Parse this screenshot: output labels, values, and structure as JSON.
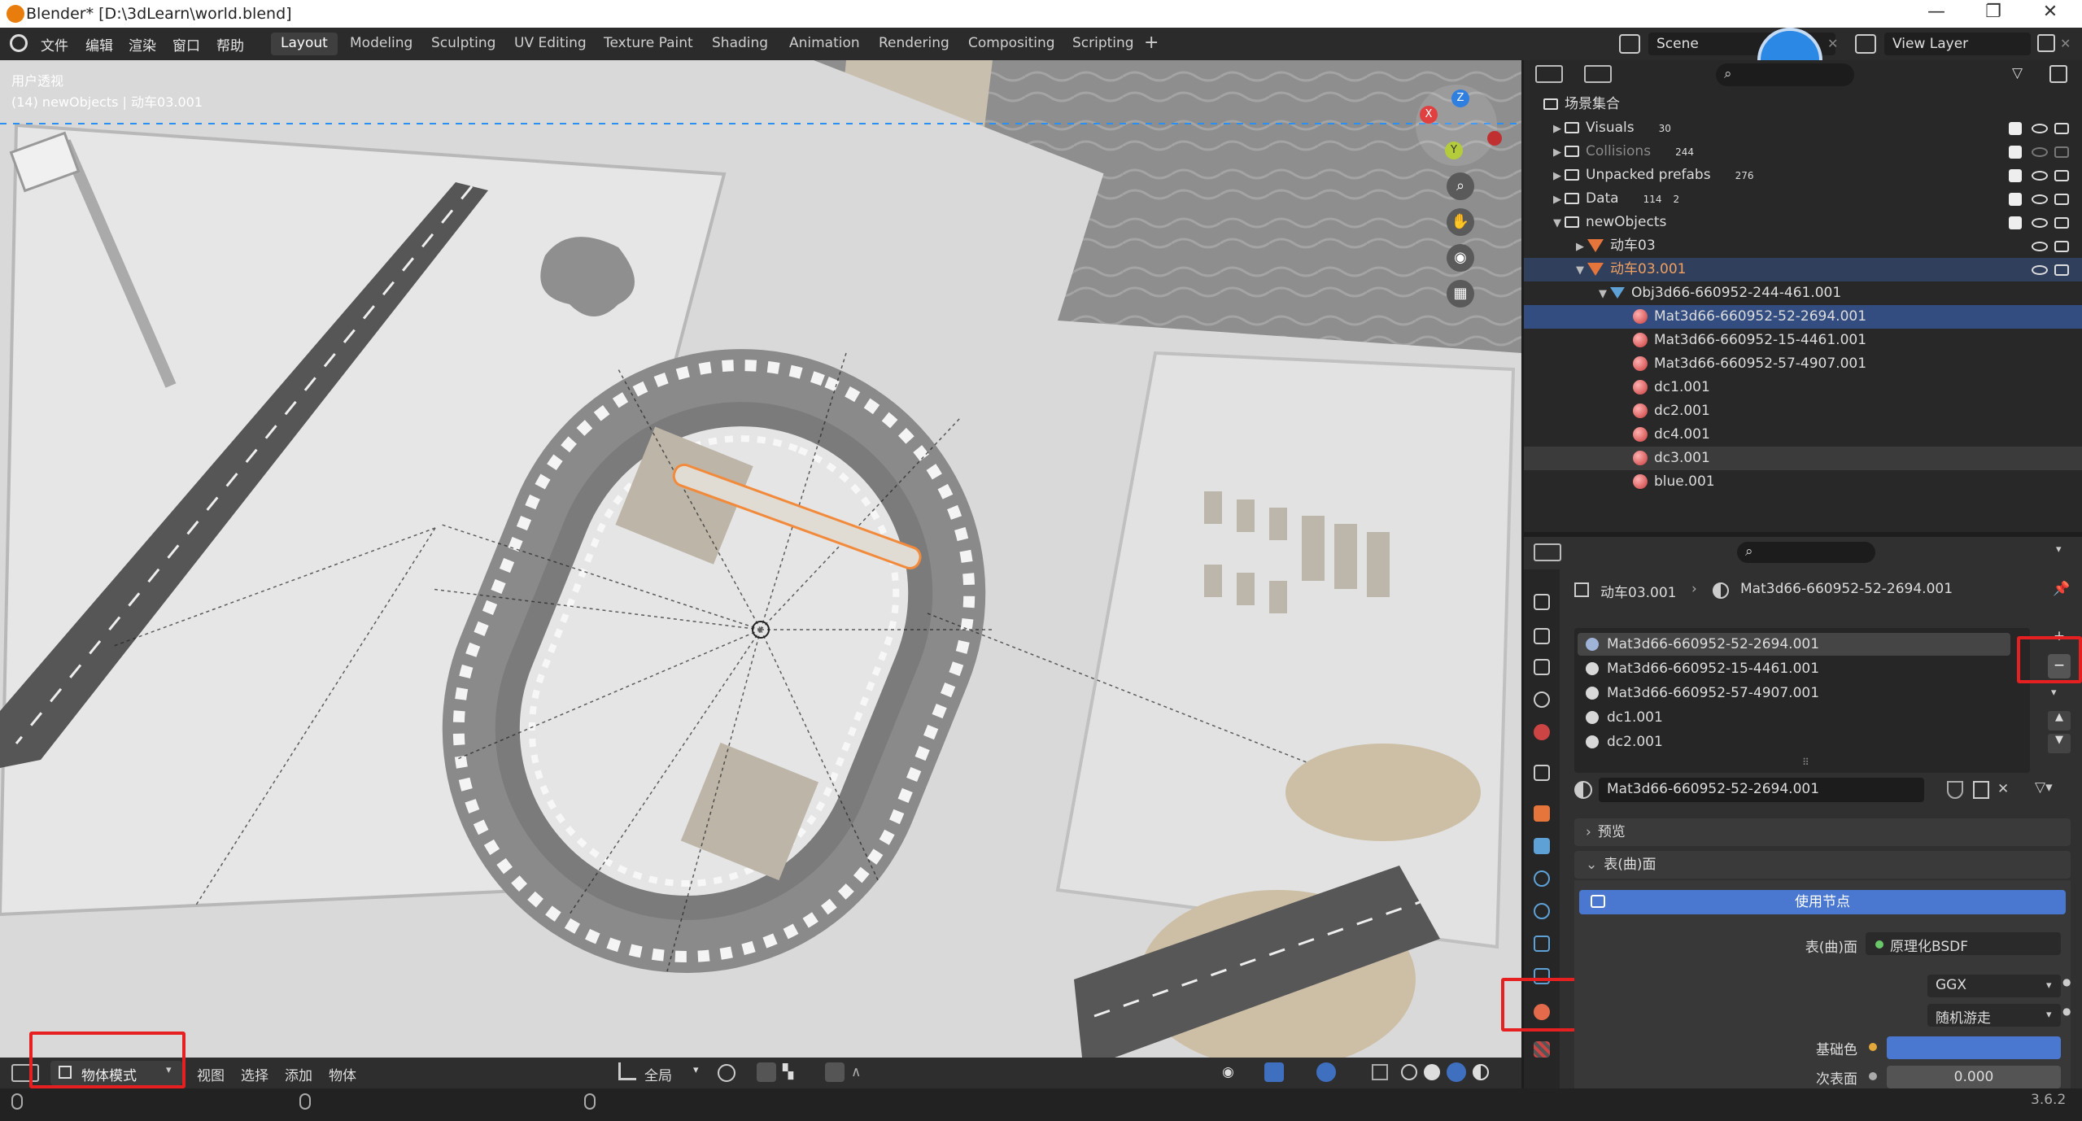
{
  "window": {
    "title": "Blender* [D:\\3dLearn\\world.blend]",
    "controls": [
      "—",
      "❐",
      "✕"
    ]
  },
  "menu": [
    "文件",
    "编辑",
    "渲染",
    "窗口",
    "帮助"
  ],
  "workspaces": [
    "Layout",
    "Modeling",
    "Sculpting",
    "UV Editing",
    "Texture Paint",
    "Shading",
    "Animation",
    "Rendering",
    "Compositing",
    "Scripting"
  ],
  "active_workspace": "Layout",
  "header_right": {
    "scene": "Scene",
    "view_layer": "View Layer"
  },
  "viewport": {
    "overlay_line1": "用户透视",
    "overlay_line2": "(14) newObjects | 动车03.001",
    "axes": {
      "x": "X",
      "y": "Y",
      "z": "Z"
    }
  },
  "viewport_footer": {
    "mode": "物体模式",
    "menus": [
      "视图",
      "选择",
      "添加",
      "物体"
    ],
    "transform": "全局"
  },
  "outliner": {
    "root": "场景集合",
    "items": [
      {
        "label": "Visuals",
        "type": "collection",
        "badge": "30",
        "checked": true
      },
      {
        "label": "Collisions",
        "type": "collection",
        "badge": "244",
        "checked": true,
        "dim": true
      },
      {
        "label": "Unpacked prefabs",
        "type": "collection",
        "badge": "276",
        "checked": true
      },
      {
        "label": "Data",
        "type": "collection",
        "badge": "114",
        "badge2": "2",
        "checked": true
      },
      {
        "label": "newObjects",
        "type": "collection",
        "checked": true,
        "expanded": true
      },
      {
        "label": "动车03",
        "type": "object",
        "indent": 1
      },
      {
        "label": "动车03.001",
        "type": "object",
        "indent": 1,
        "active": true,
        "expanded": true
      },
      {
        "label": "Obj3d66-660952-244-461.001",
        "type": "mesh",
        "indent": 2,
        "expanded": true
      },
      {
        "label": "Mat3d66-660952-52-2694.001",
        "type": "material",
        "indent": 3,
        "selected": true
      },
      {
        "label": "Mat3d66-660952-15-4461.001",
        "type": "material",
        "indent": 3
      },
      {
        "label": "Mat3d66-660952-57-4907.001",
        "type": "material",
        "indent": 3
      },
      {
        "label": "dc1.001",
        "type": "material",
        "indent": 3
      },
      {
        "label": "dc2.001",
        "type": "material",
        "indent": 3
      },
      {
        "label": "dc4.001",
        "type": "material",
        "indent": 3
      },
      {
        "label": "dc3.001",
        "type": "material",
        "indent": 3,
        "hover": true
      },
      {
        "label": "blue.001",
        "type": "material",
        "indent": 3
      }
    ]
  },
  "properties": {
    "breadcrumb_object": "动车03.001",
    "breadcrumb_material": "Mat3d66-660952-52-2694.001",
    "slots": [
      "Mat3d66-660952-52-2694.001",
      "Mat3d66-660952-15-4461.001",
      "Mat3d66-660952-57-4907.001",
      "dc1.001",
      "dc2.001"
    ],
    "active_material": "Mat3d66-660952-52-2694.001",
    "panel_preview": "预览",
    "panel_surface": "表(曲)面",
    "use_nodes": "使用节点",
    "surface_label": "表(曲)面",
    "surface_value": "原理化BSDF",
    "distribution": "GGX",
    "subsurface_method": "随机游走",
    "base_color_label": "基础色",
    "base_color": "#4a78d0",
    "subsurface_label": "次表面",
    "subsurface_value": "0.000"
  },
  "status": {
    "version": "3.6.2"
  },
  "colors": {
    "accent": "#4a78d0",
    "selection": "#e5753a",
    "annotation": "#e62020"
  }
}
